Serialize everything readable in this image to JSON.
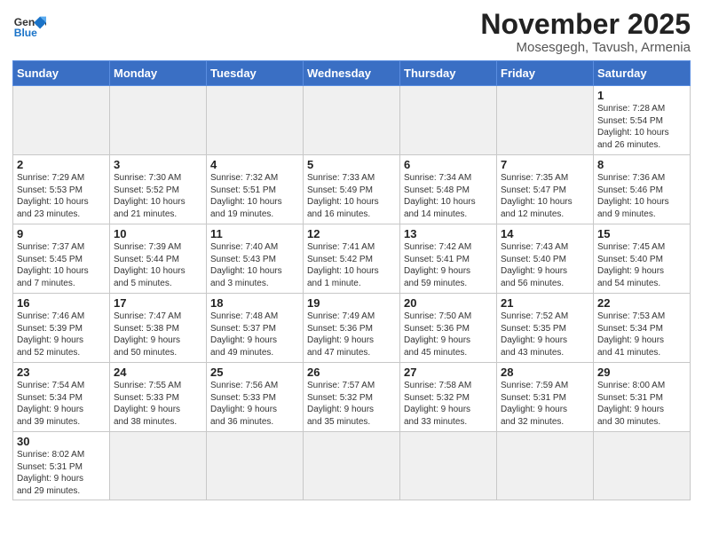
{
  "header": {
    "logo_general": "General",
    "logo_blue": "Blue",
    "month_title": "November 2025",
    "location": "Mosesgegh, Tavush, Armenia"
  },
  "days_of_week": [
    "Sunday",
    "Monday",
    "Tuesday",
    "Wednesday",
    "Thursday",
    "Friday",
    "Saturday"
  ],
  "weeks": [
    [
      {
        "day": "",
        "info": "",
        "empty": true
      },
      {
        "day": "",
        "info": "",
        "empty": true
      },
      {
        "day": "",
        "info": "",
        "empty": true
      },
      {
        "day": "",
        "info": "",
        "empty": true
      },
      {
        "day": "",
        "info": "",
        "empty": true
      },
      {
        "day": "",
        "info": "",
        "empty": true
      },
      {
        "day": "1",
        "info": "Sunrise: 7:28 AM\nSunset: 5:54 PM\nDaylight: 10 hours\nand 26 minutes."
      }
    ],
    [
      {
        "day": "2",
        "info": "Sunrise: 7:29 AM\nSunset: 5:53 PM\nDaylight: 10 hours\nand 23 minutes."
      },
      {
        "day": "3",
        "info": "Sunrise: 7:30 AM\nSunset: 5:52 PM\nDaylight: 10 hours\nand 21 minutes."
      },
      {
        "day": "4",
        "info": "Sunrise: 7:32 AM\nSunset: 5:51 PM\nDaylight: 10 hours\nand 19 minutes."
      },
      {
        "day": "5",
        "info": "Sunrise: 7:33 AM\nSunset: 5:49 PM\nDaylight: 10 hours\nand 16 minutes."
      },
      {
        "day": "6",
        "info": "Sunrise: 7:34 AM\nSunset: 5:48 PM\nDaylight: 10 hours\nand 14 minutes."
      },
      {
        "day": "7",
        "info": "Sunrise: 7:35 AM\nSunset: 5:47 PM\nDaylight: 10 hours\nand 12 minutes."
      },
      {
        "day": "8",
        "info": "Sunrise: 7:36 AM\nSunset: 5:46 PM\nDaylight: 10 hours\nand 9 minutes."
      }
    ],
    [
      {
        "day": "9",
        "info": "Sunrise: 7:37 AM\nSunset: 5:45 PM\nDaylight: 10 hours\nand 7 minutes."
      },
      {
        "day": "10",
        "info": "Sunrise: 7:39 AM\nSunset: 5:44 PM\nDaylight: 10 hours\nand 5 minutes."
      },
      {
        "day": "11",
        "info": "Sunrise: 7:40 AM\nSunset: 5:43 PM\nDaylight: 10 hours\nand 3 minutes."
      },
      {
        "day": "12",
        "info": "Sunrise: 7:41 AM\nSunset: 5:42 PM\nDaylight: 10 hours\nand 1 minute."
      },
      {
        "day": "13",
        "info": "Sunrise: 7:42 AM\nSunset: 5:41 PM\nDaylight: 9 hours\nand 59 minutes."
      },
      {
        "day": "14",
        "info": "Sunrise: 7:43 AM\nSunset: 5:40 PM\nDaylight: 9 hours\nand 56 minutes."
      },
      {
        "day": "15",
        "info": "Sunrise: 7:45 AM\nSunset: 5:40 PM\nDaylight: 9 hours\nand 54 minutes."
      }
    ],
    [
      {
        "day": "16",
        "info": "Sunrise: 7:46 AM\nSunset: 5:39 PM\nDaylight: 9 hours\nand 52 minutes."
      },
      {
        "day": "17",
        "info": "Sunrise: 7:47 AM\nSunset: 5:38 PM\nDaylight: 9 hours\nand 50 minutes."
      },
      {
        "day": "18",
        "info": "Sunrise: 7:48 AM\nSunset: 5:37 PM\nDaylight: 9 hours\nand 49 minutes."
      },
      {
        "day": "19",
        "info": "Sunrise: 7:49 AM\nSunset: 5:36 PM\nDaylight: 9 hours\nand 47 minutes."
      },
      {
        "day": "20",
        "info": "Sunrise: 7:50 AM\nSunset: 5:36 PM\nDaylight: 9 hours\nand 45 minutes."
      },
      {
        "day": "21",
        "info": "Sunrise: 7:52 AM\nSunset: 5:35 PM\nDaylight: 9 hours\nand 43 minutes."
      },
      {
        "day": "22",
        "info": "Sunrise: 7:53 AM\nSunset: 5:34 PM\nDaylight: 9 hours\nand 41 minutes."
      }
    ],
    [
      {
        "day": "23",
        "info": "Sunrise: 7:54 AM\nSunset: 5:34 PM\nDaylight: 9 hours\nand 39 minutes."
      },
      {
        "day": "24",
        "info": "Sunrise: 7:55 AM\nSunset: 5:33 PM\nDaylight: 9 hours\nand 38 minutes."
      },
      {
        "day": "25",
        "info": "Sunrise: 7:56 AM\nSunset: 5:33 PM\nDaylight: 9 hours\nand 36 minutes."
      },
      {
        "day": "26",
        "info": "Sunrise: 7:57 AM\nSunset: 5:32 PM\nDaylight: 9 hours\nand 35 minutes."
      },
      {
        "day": "27",
        "info": "Sunrise: 7:58 AM\nSunset: 5:32 PM\nDaylight: 9 hours\nand 33 minutes."
      },
      {
        "day": "28",
        "info": "Sunrise: 7:59 AM\nSunset: 5:31 PM\nDaylight: 9 hours\nand 32 minutes."
      },
      {
        "day": "29",
        "info": "Sunrise: 8:00 AM\nSunset: 5:31 PM\nDaylight: 9 hours\nand 30 minutes."
      }
    ],
    [
      {
        "day": "30",
        "info": "Sunrise: 8:02 AM\nSunset: 5:31 PM\nDaylight: 9 hours\nand 29 minutes.",
        "last": true
      },
      {
        "day": "",
        "info": "",
        "empty": true,
        "last": true
      },
      {
        "day": "",
        "info": "",
        "empty": true,
        "last": true
      },
      {
        "day": "",
        "info": "",
        "empty": true,
        "last": true
      },
      {
        "day": "",
        "info": "",
        "empty": true,
        "last": true
      },
      {
        "day": "",
        "info": "",
        "empty": true,
        "last": true
      },
      {
        "day": "",
        "info": "",
        "empty": true,
        "last": true
      }
    ]
  ]
}
